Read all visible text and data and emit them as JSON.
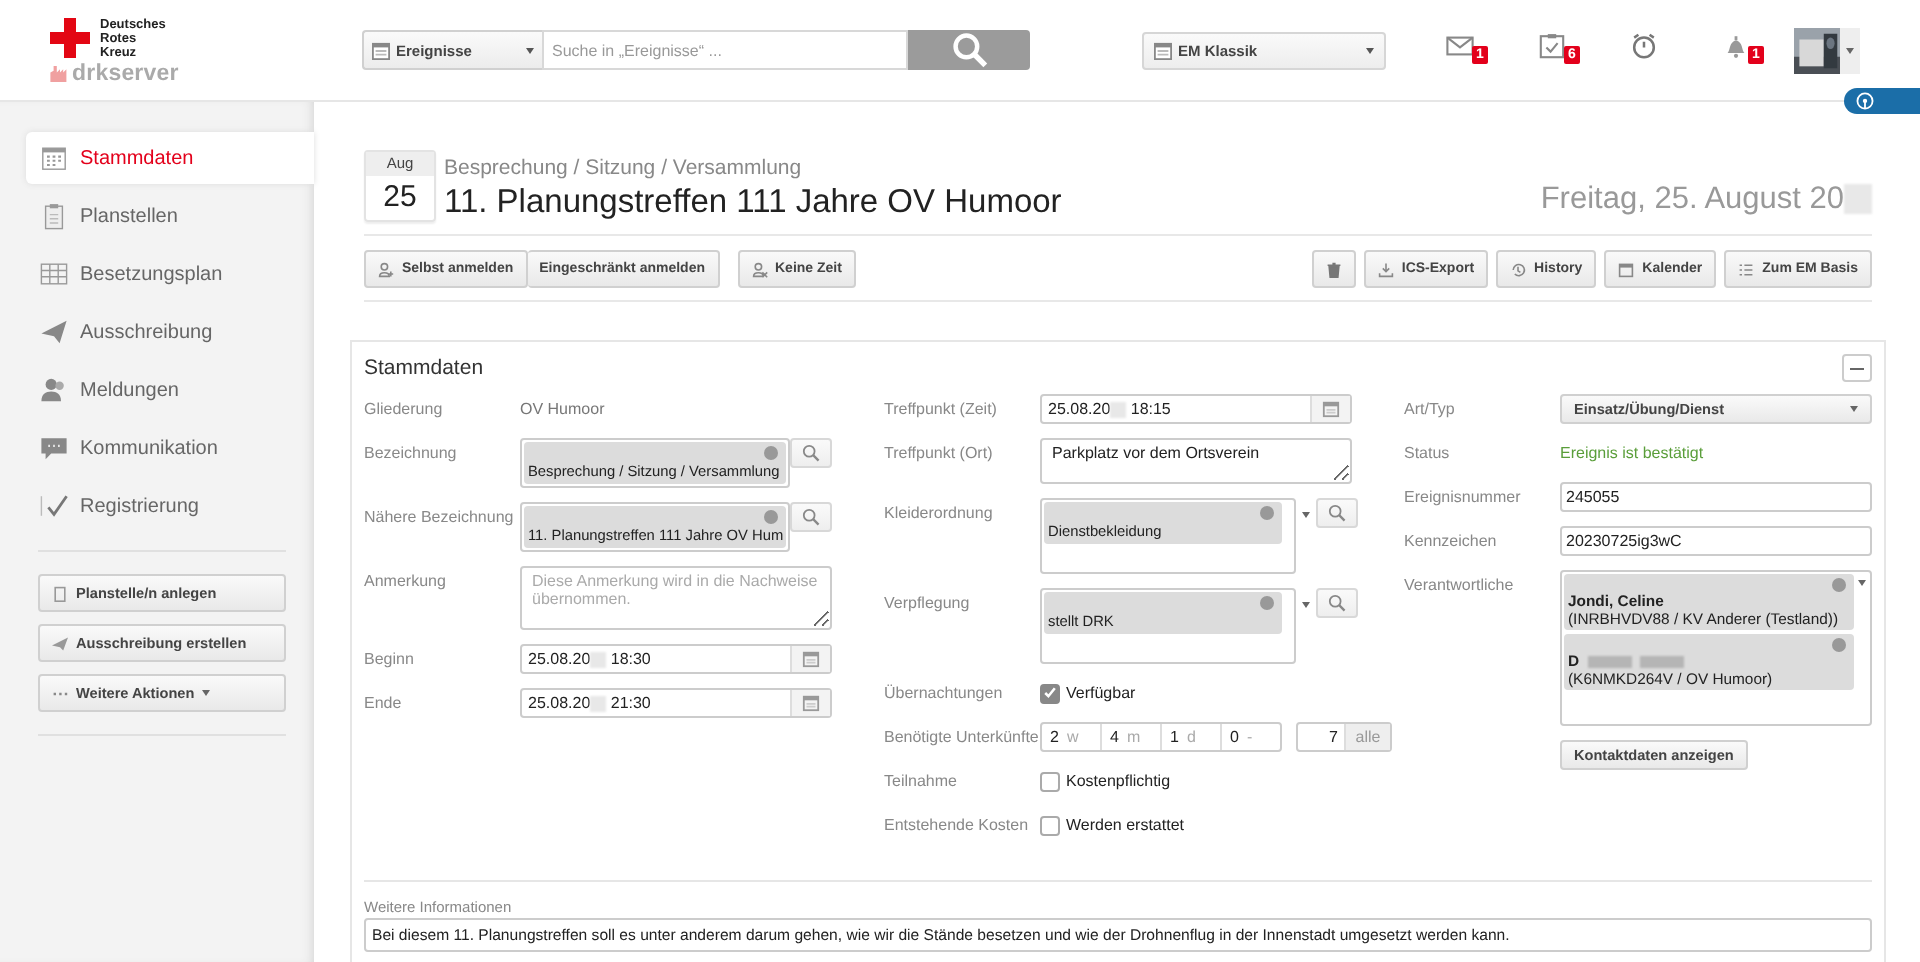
{
  "header": {
    "logo": {
      "lines": [
        "Deutsches",
        "Rotes",
        "Kreuz"
      ],
      "product": "drkserver"
    },
    "search": {
      "scope": "Ereignisse",
      "placeholder": "Suche in „Ereignisse“ ..."
    },
    "view_select": "EM Klassik",
    "notifications": [
      {
        "kind": "mail",
        "badge": "1"
      },
      {
        "kind": "tasks",
        "badge": "6"
      },
      {
        "kind": "timer"
      },
      {
        "kind": "bell",
        "badge": "1"
      }
    ]
  },
  "sidebar": {
    "items": [
      {
        "label": "Stammdaten",
        "selected": true
      },
      {
        "label": "Planstellen",
        "selected": false
      },
      {
        "label": "Besetzungsplan",
        "selected": false
      },
      {
        "label": "Ausschreibung",
        "selected": false
      },
      {
        "label": "Meldungen",
        "selected": false
      },
      {
        "label": "Kommunikation",
        "selected": false
      },
      {
        "label": "Registrierung",
        "selected": false
      }
    ],
    "actions": [
      {
        "label": "Planstelle/n anlegen",
        "has_menu": false
      },
      {
        "label": "Ausschreibung erstellen",
        "has_menu": false
      },
      {
        "label": "Weitere Aktionen",
        "has_menu": true
      }
    ]
  },
  "event": {
    "month": "Aug",
    "day": "25",
    "category": "Besprechung / Sitzung / Versammlung",
    "title": "11. Planungstreffen 111 Jahre OV Humoor",
    "date": "Freitag, 25. August 20",
    "date_redacted": true
  },
  "toolbar": {
    "left": [
      {
        "kind": "group",
        "labels": [
          "Selbst anmelden",
          "Eingeschränkt  anmelden"
        ]
      },
      {
        "kind": "button",
        "label": "Keine Zeit"
      }
    ],
    "right": [
      {
        "kind": "trash"
      },
      {
        "kind": "export",
        "label": "ICS-Export"
      },
      {
        "kind": "history",
        "label": "History"
      },
      {
        "kind": "calendar",
        "label": "Kalender"
      },
      {
        "kind": "list",
        "label": "Zum EM Basis"
      }
    ]
  },
  "panel": {
    "title": "Stammdaten",
    "columns": [
      [
        {
          "label": "Gliederung",
          "kind": "static",
          "value": "OV Humoor"
        },
        {
          "label": "Bezeichnung",
          "kind": "tag",
          "value": "Besprechung / Sitzung / Versammlung"
        },
        {
          "label": "Nähere Bezeichnung",
          "kind": "tag",
          "value": "11. Planungstreffen 111 Jahre OV Hum"
        },
        {
          "label": "Anmerkung",
          "kind": "textarea",
          "placeholder": "Diese Anmerkung wird in die Nachweise übernommen."
        },
        {
          "label": "Beginn",
          "kind": "date",
          "value": "25.08.20",
          "time": "18:30"
        },
        {
          "label": "Ende",
          "kind": "date",
          "value": "25.08.20",
          "time": "21:30"
        }
      ],
      [
        {
          "label": "Treffpunkt (Zeit)",
          "kind": "date",
          "value": "25.08.20",
          "time": "18:15"
        },
        {
          "label": "Treffpunkt (Ort)",
          "kind": "textarea",
          "value": "Parkplatz vor dem Ortsverein"
        },
        {
          "label": "Kleiderordnung",
          "kind": "tagbox",
          "value": "Dienstbekleidung"
        },
        {
          "label": "Verpflegung",
          "kind": "tagbox",
          "value": "stellt DRK"
        },
        {
          "label": "Übernachtungen",
          "kind": "checkbox",
          "checked": true,
          "text": "Verfügbar"
        },
        {
          "label": "Benötigte Unterkünfte",
          "kind": "counts",
          "segments": [
            {
              "value": "2",
              "unit": "w"
            },
            {
              "value": "4",
              "unit": "m"
            },
            {
              "value": "1",
              "unit": "d"
            },
            {
              "value": "0",
              "unit": "-"
            }
          ],
          "total": "7",
          "total_unit": "alle"
        },
        {
          "label": "Teilnahme",
          "kind": "checkbox",
          "checked": false,
          "text": "Kostenpflichtig"
        },
        {
          "label": "Entstehende Kosten",
          "kind": "checkbox",
          "checked": false,
          "text": "Werden erstattet"
        }
      ],
      [
        {
          "label": "Art/Typ",
          "kind": "select",
          "value": "Einsatz/Übung/Dienst"
        },
        {
          "label": "Status",
          "kind": "status",
          "value": "Ereignis ist bestätigt",
          "color": "#5a9e3a"
        },
        {
          "label": "Ereignisnummer",
          "kind": "input",
          "value": "245055"
        },
        {
          "label": "Kennzeichen",
          "kind": "input",
          "value": "20230725ig3wC"
        },
        {
          "label": "Verantwortliche",
          "kind": "people",
          "people": [
            {
              "name": "Jondi, Celine",
              "redacted": false,
              "detail": "(INRBHVDV88 / KV Anderer (Testland))"
            },
            {
              "name": "D",
              "redacted": true,
              "detail": "(K6NMKD264V / OV Humoor)"
            }
          ]
        },
        {
          "kind": "button",
          "text": "Kontaktdaten anzeigen"
        }
      ]
    ],
    "notes": {
      "label": "Weitere Informationen",
      "value": "Bei diesem 11. Planungstreffen soll es unter anderem darum gehen, wie wir die Stände besetzen und wie der Drohnenflug in der Innenstadt umgesetzt werden kann."
    }
  }
}
